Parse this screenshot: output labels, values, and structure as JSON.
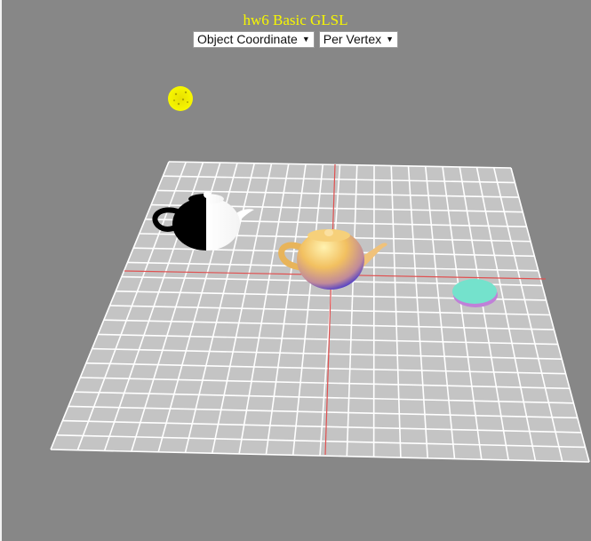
{
  "page": {
    "title": "hw6 Basic GLSL",
    "title_color": "#f7f700",
    "background": "#878787"
  },
  "controls": {
    "coordinate_select": {
      "value": "Object Coordinate",
      "icon": "triangle-down-icon"
    },
    "shading_select": {
      "value": "Per Vertex",
      "icon": "triangle-down-icon"
    }
  },
  "scene": {
    "floor_color": "#c4c4c4",
    "grid_color": "#ffffff",
    "axis_color": "#e05050",
    "light_color": "#f7f700",
    "objects": [
      "light",
      "black-white-teapot",
      "golden-teapot",
      "cyan-disc"
    ]
  }
}
